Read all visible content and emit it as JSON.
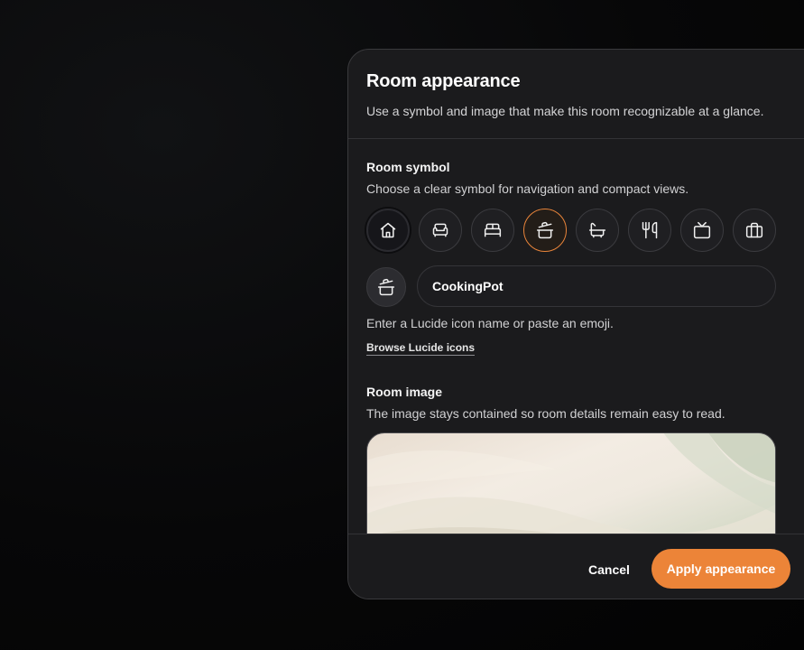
{
  "dialog": {
    "title": "Room appearance",
    "description": "Use a symbol and image that make this room recognizable at a glance."
  },
  "room_symbol": {
    "title": "Room symbol",
    "description": "Choose a clear symbol for navigation and compact views.",
    "options": [
      {
        "icon": "house-icon"
      },
      {
        "icon": "armchair-icon"
      },
      {
        "icon": "bed-icon"
      },
      {
        "icon": "cooking-pot-icon",
        "selected": true
      },
      {
        "icon": "bath-icon"
      },
      {
        "icon": "utensils-icon"
      },
      {
        "icon": "tv-icon"
      },
      {
        "icon": "briefcase-icon"
      }
    ],
    "preview_icon": "cooking-pot-icon",
    "input_value": "CookingPot",
    "helper": "Enter a Lucide icon name or paste an emoji.",
    "browse_link": "Browse Lucide icons"
  },
  "room_image": {
    "title": "Room image",
    "description": "The image stays contained so room details remain easy to read."
  },
  "footer": {
    "cancel_label": "Cancel",
    "apply_label": "Apply appearance"
  },
  "colors": {
    "accent": "#ec8438",
    "dialog_bg": "#1b1b1d",
    "page_bg": "#050505"
  }
}
